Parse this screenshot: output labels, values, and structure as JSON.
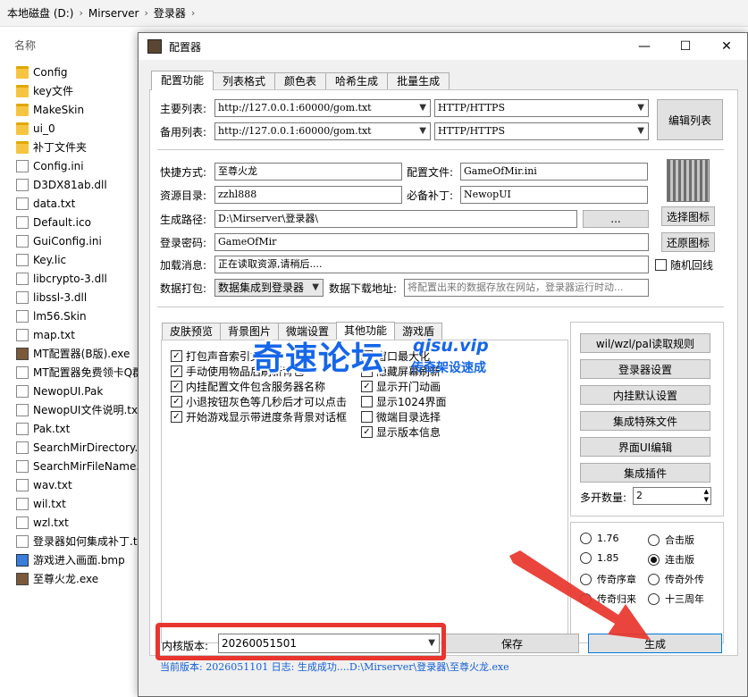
{
  "explorer": {
    "breadcrumbs": [
      "本地磁盘 (D:)",
      "Mirserver",
      "登录器"
    ],
    "column_name": "名称",
    "files": [
      {
        "name": "Config",
        "icon": "folder"
      },
      {
        "name": "key文件",
        "icon": "folder"
      },
      {
        "name": "MakeSkin",
        "icon": "folder"
      },
      {
        "name": "ui_0",
        "icon": "folder"
      },
      {
        "name": "补丁文件夹",
        "icon": "folder"
      },
      {
        "name": "Config.ini",
        "icon": "file"
      },
      {
        "name": "D3DX81ab.dll",
        "icon": "file"
      },
      {
        "name": "data.txt",
        "icon": "file"
      },
      {
        "name": "Default.ico",
        "icon": "file"
      },
      {
        "name": "GuiConfig.ini",
        "icon": "file"
      },
      {
        "name": "Key.lic",
        "icon": "file"
      },
      {
        "name": "libcrypto-3.dll",
        "icon": "file"
      },
      {
        "name": "libssl-3.dll",
        "icon": "file"
      },
      {
        "name": "lm56.Skin",
        "icon": "file"
      },
      {
        "name": "map.txt",
        "icon": "file"
      },
      {
        "name": "MT配置器(B版).exe",
        "icon": "exe"
      },
      {
        "name": "MT配置器免费领卡Q群",
        "icon": "file"
      },
      {
        "name": "NewopUI.Pak",
        "icon": "file"
      },
      {
        "name": "NewopUI文件说明.txt",
        "icon": "file"
      },
      {
        "name": "Pak.txt",
        "icon": "file"
      },
      {
        "name": "SearchMirDirectory.t",
        "icon": "file"
      },
      {
        "name": "SearchMirFileName.t",
        "icon": "file"
      },
      {
        "name": "wav.txt",
        "icon": "file"
      },
      {
        "name": "wil.txt",
        "icon": "file"
      },
      {
        "name": "wzl.txt",
        "icon": "file"
      },
      {
        "name": "登录器如何集成补丁.t",
        "icon": "file"
      },
      {
        "name": "游戏进入画面.bmp",
        "icon": "image"
      },
      {
        "name": "至尊火龙.exe",
        "icon": "exe"
      }
    ]
  },
  "window": {
    "title": "配置器",
    "min_glyph": "—",
    "max_glyph": "☐",
    "close_glyph": "✕",
    "tabs": [
      "配置功能",
      "列表格式",
      "颜色表",
      "哈希生成",
      "批量生成"
    ]
  },
  "config": {
    "primary_list_label": "主要列表:",
    "primary_list_url": "http://127.0.0.1:60000/gom.txt",
    "primary_list_proto": "HTTP/HTTPS",
    "backup_list_label": "备用列表:",
    "backup_list_url": "http://127.0.0.1:60000/gom.txt",
    "backup_list_proto": "HTTP/HTTPS",
    "edit_list_btn": "编辑列表",
    "shortcut_label": "快捷方式:",
    "shortcut_value": "至尊火龙",
    "config_file_label": "配置文件:",
    "config_file_value": "GameOfMir.ini",
    "resource_dir_label": "资源目录:",
    "resource_dir_value": "zzhl888",
    "required_patch_label": "必备补丁:",
    "required_patch_value": "NewopUI",
    "output_path_label": "生成路径:",
    "output_path_value": "D:\\Mirserver\\登录器\\",
    "browse_btn": "...",
    "login_pwd_label": "登录密码:",
    "login_pwd_value": "GameOfMir",
    "loading_msg_label": "加载消息:",
    "loading_msg_value": "正在读取资源,请稍后....",
    "data_pack_label": "数据打包:",
    "data_pack_value": "数据集成到登录器",
    "data_url_label": "数据下载地址:",
    "data_url_placeholder": "将配置出来的数据存放在网站，登录器运行时动...",
    "select_icon_btn": "选择图标",
    "restore_icon_btn": "还原图标",
    "random_loop_label": "随机回线"
  },
  "inner_tabs": [
    "皮肤预览",
    "背景图片",
    "微端设置",
    "其他功能",
    "游戏盾"
  ],
  "options_left": [
    {
      "label": "打包声音索引文件",
      "checked": true
    },
    {
      "label": "手动使用物品后刷新背包",
      "checked": true
    },
    {
      "label": "内挂配置文件包含服务器名称",
      "checked": true
    },
    {
      "label": "小退按钮灰色等几秒后才可以点击",
      "checked": true
    },
    {
      "label": "开始游戏显示带进度条背景对话框",
      "checked": true
    }
  ],
  "options_right": [
    {
      "label": "窗口最大化",
      "checked": false
    },
    {
      "label": "隐藏屏幕刷新",
      "checked": false
    },
    {
      "label": "显示开门动画",
      "checked": true
    },
    {
      "label": "显示1024界面",
      "checked": false
    },
    {
      "label": "微端目录选择",
      "checked": false
    },
    {
      "label": "显示版本信息",
      "checked": true
    }
  ],
  "side_buttons": [
    "wil/wzl/pal读取规则",
    "登录器设置",
    "内挂默认设置",
    "集成特殊文件",
    "界面UI编辑",
    "集成插件"
  ],
  "multi_open": {
    "label": "多开数量:",
    "value": "2"
  },
  "versions": [
    {
      "label": "1.76",
      "selected": false
    },
    {
      "label": "合击版",
      "selected": false
    },
    {
      "label": "1.85",
      "selected": false
    },
    {
      "label": "连击版",
      "selected": true
    },
    {
      "label": "传奇序章",
      "selected": false
    },
    {
      "label": "传奇外传",
      "selected": false
    },
    {
      "label": "传奇归来",
      "selected": false
    },
    {
      "label": "十三周年",
      "selected": false
    }
  ],
  "bottom": {
    "kernel_label": "内核版本:",
    "kernel_value": "20260051501",
    "save_btn": "保存",
    "generate_btn": "生成",
    "status_text": "当前版本: 2026051101 日志: 生成成功....D:\\Mirserver\\登录器\\至尊火龙.exe"
  },
  "watermark": {
    "title": "奇速论坛",
    "url": "qisu.vip",
    "subtitle": "传奇架设速成"
  },
  "colors": {
    "accent": "#0078d7",
    "highlight_red": "#e8352d",
    "watermark_blue": "#1666e8",
    "status_blue": "#1560d8"
  }
}
